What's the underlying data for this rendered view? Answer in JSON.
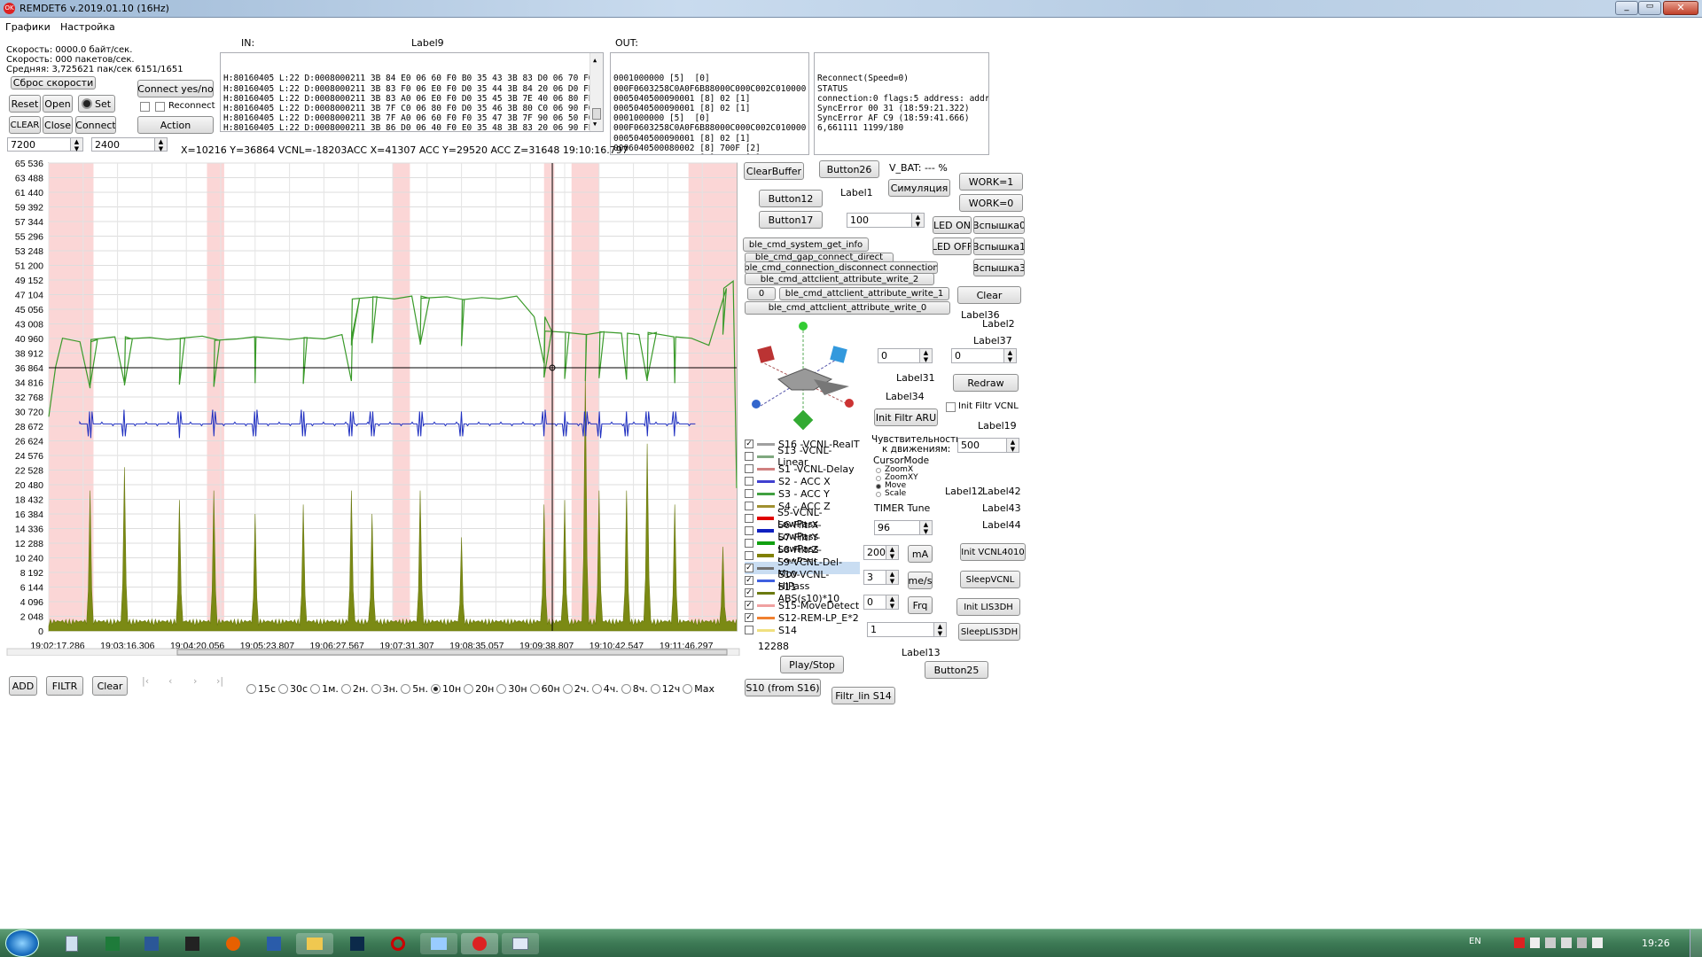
{
  "window": {
    "title": "REMDET6 v.2019.01.10 (16Hz)",
    "icon": "app-red-icon"
  },
  "menu": [
    "Графики",
    "Настройка"
  ],
  "stats": {
    "speed1": "Скорость: 0000.0 байт/сек.",
    "speed2": "Скорость: 000 пакетов/сек.",
    "avg": "Средняя: 3,725621 пак/сек 6151/1651",
    "reset_speed": "Сброс скорости"
  },
  "left_buttons": {
    "reset": "Reset",
    "open": "Open",
    "set": "Set",
    "clear": "CLEAR",
    "close": "Close",
    "connect": "Connect",
    "connect_yes_no": "Connect yes/no",
    "reconnect": "Reconnect",
    "action": "Action"
  },
  "spins": {
    "a": "7200",
    "b": "2400"
  },
  "labels": {
    "in": "IN:",
    "label9": "Label9",
    "out": "OUT:"
  },
  "in_lines": [
    "H:80160405 L:22 D:0008000211 3B 84 E0 06 60 F0 B0 35 43 3B 83 D0 06 70 F0 D0 35",
    "H:80160405 L:22 D:0008000211 3B 83 F0 06 E0 F0 D0 35 44 3B 84 20 06 D0 FE D0 35",
    "H:80160405 L:22 D:0008000211 3B 83 A0 06 E0 F0 D0 35 45 3B 7E 40 06 80 FE E0 35",
    "H:80160405 L:22 D:0008000211 3B 7F C0 06 80 F0 D0 35 46 3B 80 C0 06 90 F0 E0 35",
    "H:80160405 L:22 D:0008000211 3B 7F A0 06 60 F0 F0 35 47 3B 7F 90 06 50 F0 C0 35",
    "H:80160405 L:22 D:0008000211 3B 86 D0 06 40 F0 E0 35 48 3B 83 20 06 90 FE D0 35",
    "H:80160405 L:22 D:0008000211 3B 84 00 06 A0 FE D0 35 49 3B 81 F0 06 D0 FE D0 35"
  ],
  "out_lines": [
    "0001000000 [5]  [0]",
    "000F0603258C0A0F6B88000C000C002C010000 [19]",
    "0005040500090001 [8] 02 [1]",
    "0005040500090001 [8] 02 [1]",
    "0001000000 [5]  [0]",
    "000F0603258C0A0F6B88000C000C002C010000 [19]",
    "0005040500090001 [8] 02 [1]",
    "0006040500080002 [8] 700F [2]",
    "0006040500080002 [8] 700F [2]"
  ],
  "log_lines": [
    "Reconnect(Speed=0)",
    "STATUS",
    "connection:0 flags:5 address: address_t",
    "SyncError 00 31 (18:59:21.322)",
    "SyncError AF C9 (18:59:41.666)",
    "6,661111 1199/180"
  ],
  "readout": "X=10216 Y=36864  VCNL=-18203ACC X=41307   ACC Y=29520  ACC Z=31648   19:10:16.797",
  "chart_data": {
    "type": "line",
    "y_ticks": [
      "65 536",
      "63 488",
      "61 440",
      "59 392",
      "57 344",
      "55 296",
      "53 248",
      "51 200",
      "49 152",
      "47 104",
      "45 056",
      "43 008",
      "40 960",
      "38 912",
      "36 864",
      "34 816",
      "32 768",
      "30 720",
      "28 672",
      "26 624",
      "24 576",
      "22 528",
      "20 480",
      "18 432",
      "16 384",
      "14 336",
      "12 288",
      "10 240",
      "8 192",
      "6 144",
      "4 096",
      "2 048",
      "0"
    ],
    "x_ticks": [
      "19:02:17.286",
      "19:03:16.306",
      "19:04:20.056",
      "19:05:23.807",
      "19:06:27.567",
      "19:07:31.307",
      "19:08:35.057",
      "19:09:38.807",
      "19:10:42.547",
      "19:11:46.297"
    ],
    "ylim": [
      0,
      65536
    ],
    "cursor": {
      "x": "19:10:16.797",
      "y": 36864
    },
    "series": [
      {
        "name": "S16 -VCNL-RealT",
        "color": "#3a9a2a",
        "baseline": [
          41000,
          40500,
          40800,
          41200,
          40900,
          41100,
          40800,
          41000,
          41300,
          40700,
          40900,
          41200,
          41000,
          40800,
          41100,
          40900,
          41500,
          46500,
          46800,
          46500,
          46900,
          46600,
          46800,
          46400,
          46700,
          46500,
          46900,
          44000,
          42000,
          41800,
          41500,
          41900,
          41700,
          41500,
          41800,
          41200,
          41000,
          40000,
          48000
        ]
      },
      {
        "name": "S2 - ACC X",
        "color": "#1f2fc0",
        "baseline": [
          29000
        ]
      },
      {
        "name": "S11 ABS(s10)*10",
        "color": "#6b7a10",
        "baseline": [
          1200
        ]
      }
    ]
  },
  "time_scrollbar": "12288",
  "bottom_buttons": {
    "add": "ADD",
    "filtr": "FILTR",
    "clear": "Clear"
  },
  "time_scale": {
    "options": [
      "15c",
      "30c",
      "1м.",
      "2н.",
      "3н.",
      "5н.",
      "10н",
      "20н",
      "30н",
      "60н",
      "2ч.",
      "4ч.",
      "8ч.",
      "12ч",
      "Max"
    ],
    "selected": "10н"
  },
  "right": {
    "clear_buffer": "ClearBuffer",
    "button26": "Button26",
    "vbat": "V_BAT: ---  %",
    "work1": "WORK=1",
    "work0": "WORK=0",
    "button12": "Button12",
    "label1": "Label1",
    "simulation": "Симуляция",
    "button17": "Button17",
    "spin100": "100",
    "led_on": "LED ON",
    "led_off": "LED OFF",
    "flash0": "Вспышка0",
    "flash1": "Вспышка1",
    "flash3": "Вспышка3",
    "ble_info": "ble_cmd_system_get_info",
    "ble_gap": "ble_cmd_gap_connect_direct",
    "ble_disc": "ble_cmd_connection_disconnect connection",
    "ble_w2": "ble_cmd_attclient_attribute_write_2",
    "ble_w1_idx": "0",
    "ble_w1": "ble_cmd_attclient_attribute_write_1",
    "ble_w0": "ble_cmd_attclient_attribute_write_0",
    "clear": "Clear",
    "label36": "Label36",
    "label2": "Label2",
    "label37": "Label37",
    "spin0a": "0",
    "spin0b": "0",
    "label31": "Label31",
    "redraw": "Redraw",
    "label34": "Label34",
    "init_filtr": "Init Filtr ARU",
    "init_filtr_vcnl": "Init Filtr VCNL",
    "label19": "Label19",
    "sensitivity": "Чувствительность\nк движениям:",
    "sens_val": "500",
    "cursor_mode": "CursorMode",
    "cursor_opts": [
      "ZoomX",
      "ZoomXY",
      "Move",
      "Scale"
    ],
    "cursor_sel": "Move",
    "label12": "Label12",
    "label42": "Label42",
    "label43": "Label43",
    "label44": "Label44",
    "timer_tune": "TIMER Tune",
    "timer_val": "96",
    "ma_val": "200",
    "ma": "mA",
    "ms_val": "3",
    "ms": "me/s",
    "frq_val": "0",
    "frq": "Frq",
    "spin1": "1",
    "init_vcnl": "Init VCNL4010",
    "sleep_vcnl": "SleepVCNL",
    "init_lis": "Init LIS3DH",
    "sleep_lis": "SleepLIS3DH",
    "play_stop": "Play/Stop",
    "label13": "Label13",
    "button25": "Button25",
    "s10": "S10 (from S16)",
    "filtr_lin": "Filtr_lin S14"
  },
  "series_list": [
    {
      "label": "S16 -VCNL-RealT",
      "checked": true,
      "color": "#a0a0a0",
      "sel": false
    },
    {
      "label": "S13 -VCNL-Linear",
      "checked": false,
      "color": "#7fa87f",
      "sel": false
    },
    {
      "label": "S1 -VCNL-Delay",
      "checked": false,
      "color": "#d08080",
      "sel": false
    },
    {
      "label": "S2 - ACC X",
      "checked": false,
      "color": "#4040d0",
      "sel": false
    },
    {
      "label": "S3 - ACC Y",
      "checked": false,
      "color": "#40a040",
      "sel": false
    },
    {
      "label": "S4 - ACC Z",
      "checked": false,
      "color": "#a09030",
      "sel": false
    },
    {
      "label": "S5-VCNL-LowPass",
      "checked": false,
      "color": "#e00000",
      "sel": false
    },
    {
      "label": "S6-FiltrX-LowPass",
      "checked": false,
      "color": "#1020c0",
      "sel": false
    },
    {
      "label": "S7-FiltrY-LowPass",
      "checked": false,
      "color": "#10a010",
      "sel": false
    },
    {
      "label": "S8-FiltrZ-LowPass",
      "checked": false,
      "color": "#808000",
      "sel": false
    },
    {
      "label": "S9-VCNL-Del-Mov",
      "checked": true,
      "color": "#707070",
      "sel": true
    },
    {
      "label": "S10-VCNL-HiPass",
      "checked": true,
      "color": "#4060e0",
      "sel": false
    },
    {
      "label": "S11 ABS(s10)*10",
      "checked": true,
      "color": "#6b7a10",
      "sel": false
    },
    {
      "label": "S15-MoveDetect",
      "checked": true,
      "color": "#f0a0a0",
      "sel": false
    },
    {
      "label": "S12-REM-LP_E*2",
      "checked": true,
      "color": "#f08030",
      "sel": false
    },
    {
      "label": "S14",
      "checked": false,
      "color": "#f0e080",
      "sel": false
    }
  ],
  "taskbar": {
    "lang": "EN",
    "clock": "19:26"
  }
}
